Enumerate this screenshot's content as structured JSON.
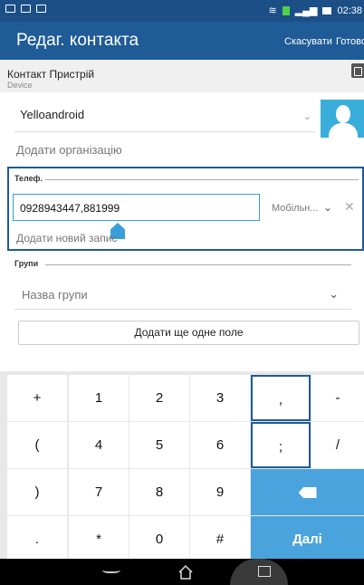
{
  "statusbar": {
    "time": "02:38"
  },
  "appbar": {
    "title": "Редаг. контакта",
    "cancel": "Скасувати",
    "done": "Готово"
  },
  "account": {
    "title": "Контакт Пристрій",
    "subtitle": "Device"
  },
  "name": {
    "value": "Yelloandroid"
  },
  "organization": {
    "placeholder": "Додати організацію"
  },
  "phone": {
    "section_label": "Телеф.",
    "value": "0928943447,881999",
    "type": "Мобільн...",
    "add_entry": "Додати новий запис"
  },
  "groups": {
    "section_label": "Групи",
    "placeholder": "Назва групи"
  },
  "add_field": {
    "label": "Додати ще одне поле"
  },
  "keyboard": {
    "rows": [
      [
        "+",
        "1",
        "2",
        "3",
        ",",
        "-"
      ],
      [
        "(",
        "4",
        "5",
        "6",
        ";",
        "/"
      ],
      [
        ")",
        "7",
        "8",
        "9"
      ],
      [
        ".",
        "*",
        "0",
        "#"
      ]
    ],
    "next_label": "Далі"
  },
  "colors": {
    "appbar": "#1f5b97",
    "statusbar": "#1b4f86",
    "accent": "#4aa3dc"
  }
}
